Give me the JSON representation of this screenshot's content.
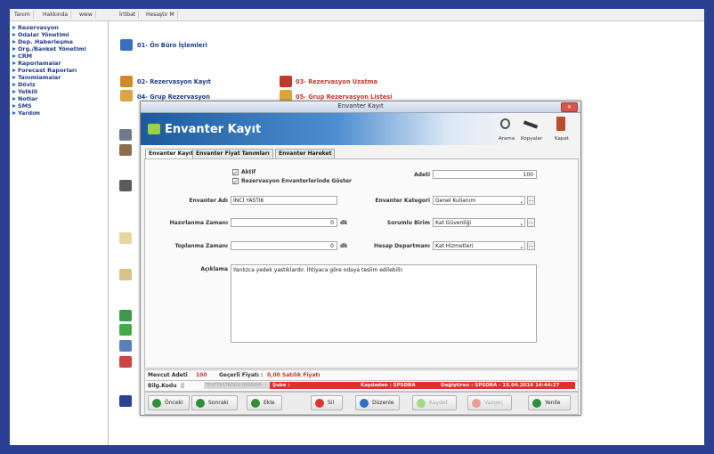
{
  "menubar": [
    "Tanım",
    "Hakkında",
    "www",
    "İrtibat",
    "Hesaştır M"
  ],
  "sidebar": [
    "Rezervasyon",
    "Odalar Yönetimi",
    "Dep. Haberleşme",
    "Org./Banket Yönetimi",
    "CRM",
    "Raporlamalar",
    "Forecast Raporları",
    "Tanımlamalar",
    "Döviz",
    "Yetkili",
    "Notlar",
    "SMS",
    "Yardım"
  ],
  "main_links": {
    "on_buro": "01- Ön Büro İşlemleri",
    "rez_kayit": "02- Rezervasyon Kayıt",
    "rez_uzatma": "03- Rezervasyon Uzatma",
    "grup_rez": "04- Grup Rezervasyon",
    "grup_liste": "05- Grup Rezervasyon Listesi"
  },
  "dialog": {
    "title": "Envanter Kayıt",
    "close": "✕",
    "header_title": "Envanter Kayıt",
    "actions": [
      "Arama",
      "Kopyalar",
      "Kapat"
    ],
    "tabs": [
      "Envanter Kayıt",
      "Envanter Fiyat Tanımları",
      "Envanter Hareket"
    ],
    "form": {
      "aktif_label": "Aktif",
      "rez_goster_label": "Rezervasyon Envanterlerinde Göster",
      "adet_label": "Adeti",
      "adet_value": "100",
      "envanter_adi_label": "Envanter Adı",
      "envanter_adi_value": "İNCİ YASTIK",
      "kategori_label": "Envanter Kategori",
      "kategori_value": "Genel Kullanım",
      "hazirlanma_label": "Hazırlanma Zamanı",
      "hazirlanma_value": "0",
      "sorumlu_label": "Sorumlu Birim",
      "sorumlu_value": "Kat Güvenliği",
      "toplanma_label": "Toplanma Zamanı",
      "toplanma_value": "0",
      "hesap_label": "Hesap Departmanı",
      "hesap_value": "Kat Hizmetleri",
      "unit": "dk",
      "aciklama_label": "Açıklama",
      "aciklama_value": "Yanlızca yedek yastıklardır. İhtiyaca göre odaya teslim edilebilir."
    },
    "status1": {
      "mevcut_label": "Mevcut Adeti",
      "mevcut_value": "100",
      "gecerli_label": "Geçerli Fiyatı :",
      "gecerli_value": "0,00 Satılık Fiyatı"
    },
    "status2": {
      "bilg_label": "Bilg.Kodu",
      "bilg_value": "||",
      "gray_text": "TESTTESTKODU 0000000",
      "sube": "Şube :",
      "kaydeden": "Kaydeden : SPSDBA",
      "degistiren": "Değiştiren : SPSDBA - 15.04.2016 14:44:27"
    },
    "buttons": [
      "Önceki",
      "Sonraki",
      "Ekle",
      "Sil",
      "Düzenle",
      "Kaydet",
      "Vazgeç",
      "Yenile"
    ]
  },
  "colors": {
    "accent": "#2b3f93",
    "red": "#c0392b",
    "header": "#1d5a9c",
    "status_red": "#e0302b"
  }
}
